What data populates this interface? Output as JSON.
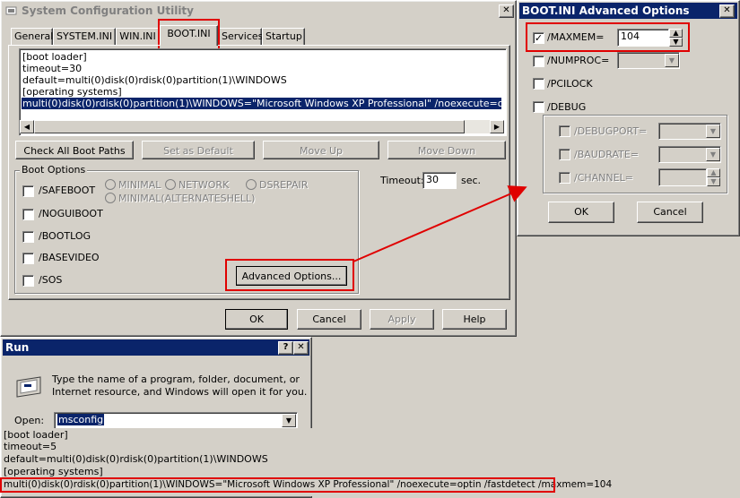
{
  "msconfig": {
    "title": "System Configuration Utility",
    "tabs": [
      "General",
      "SYSTEM.INI",
      "WIN.INI",
      "BOOT.INI",
      "Services",
      "Startup"
    ],
    "boot_lines": [
      "[boot loader]",
      "timeout=30",
      "default=multi(0)disk(0)rdisk(0)partition(1)\\WINDOWS",
      "[operating systems]",
      "multi(0)disk(0)rdisk(0)partition(1)\\WINDOWS=\"Microsoft Windows XP Professional\" /noexecute=optin /fastdetect"
    ],
    "buttons": {
      "check_all": "Check All Boot Paths",
      "set_default": "Set as Default",
      "move_up": "Move Up",
      "move_down": "Move Down",
      "advanced": "Advanced Options...",
      "ok": "OK",
      "cancel": "Cancel",
      "apply": "Apply",
      "help": "Help"
    },
    "boot_options_label": "Boot Options",
    "boot_options": [
      "/SAFEBOOT",
      "/NOGUIBOOT",
      "/BOOTLOG",
      "/BASEVIDEO",
      "/SOS"
    ],
    "radio_options": [
      "MINIMAL",
      "NETWORK",
      "DSREPAIR",
      "MINIMAL(ALTERNATESHELL)"
    ],
    "timeout_label": "Timeout:",
    "timeout_value": "30",
    "timeout_unit": "sec."
  },
  "advanced": {
    "title": "BOOT.INI Advanced Options",
    "options": [
      "/MAXMEM=",
      "/NUMPROC=",
      "/PCILOCK",
      "/DEBUG"
    ],
    "maxmem_value": "104",
    "debug_options": [
      "/DEBUGPORT=",
      "/BAUDRATE=",
      "/CHANNEL="
    ],
    "ok": "OK",
    "cancel": "Cancel"
  },
  "run": {
    "title": "Run",
    "description_1": "Type the name of a program, folder, document, or",
    "description_2": "Internet resource, and Windows will open it for you.",
    "open_label": "Open:",
    "open_value": "msconfig",
    "boot_lines": [
      "[boot loader]",
      "timeout=5",
      "default=multi(0)disk(0)rdisk(0)partition(1)\\WINDOWS",
      "[operating systems]",
      "multi(0)disk(0)rdisk(0)partition(1)\\WINDOWS=\"Microsoft Windows XP Professional\" /noexecute=optin /fastdetect /maxmem=104"
    ]
  },
  "colors": {
    "annotation": "#e00000",
    "selection": "#0a246a",
    "face": "#d4d0c8"
  }
}
